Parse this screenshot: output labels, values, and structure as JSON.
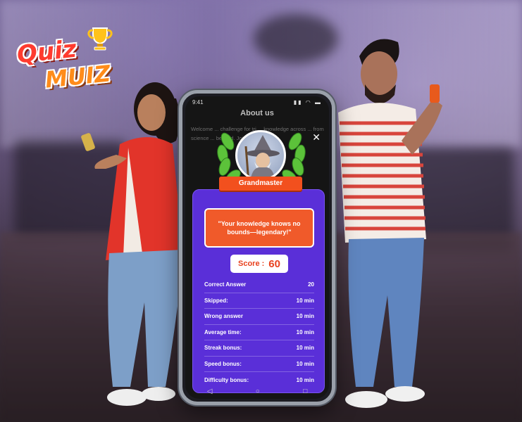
{
  "brand": {
    "logo_line1": "Quiz",
    "logo_line2": "MUIZ"
  },
  "phone": {
    "status_time": "9:41",
    "status_icons": "▮▮ ◠ ▬",
    "page_title": "About us",
    "bg_text": "Welcome ... challenge for tri ... knowledge across ... from science ... beyond. Join our ... master.",
    "close_label": "✕",
    "nav": {
      "back": "◁",
      "home": "○",
      "recent": "□"
    }
  },
  "modal": {
    "rank": "Grandmaster",
    "quote": "\"Your knowledge knows no bounds—legendary!\"",
    "score_label": "Score :",
    "score_value": "60",
    "stats": [
      {
        "label": "Correct Answer",
        "value": "20"
      },
      {
        "label": "Skipped:",
        "value": "10 min"
      },
      {
        "label": "Wrong answer",
        "value": "10 min"
      },
      {
        "label": "Average time:",
        "value": "10 min"
      },
      {
        "label": "Streak bonus:",
        "value": "10 min"
      },
      {
        "label": "Speed bonus:",
        "value": "10 min"
      },
      {
        "label": "Difficulty bonus:",
        "value": "10 min"
      }
    ]
  },
  "colors": {
    "card": "#5a2fd8",
    "accent": "#f05a2a",
    "laurel": "#5cc23a"
  }
}
